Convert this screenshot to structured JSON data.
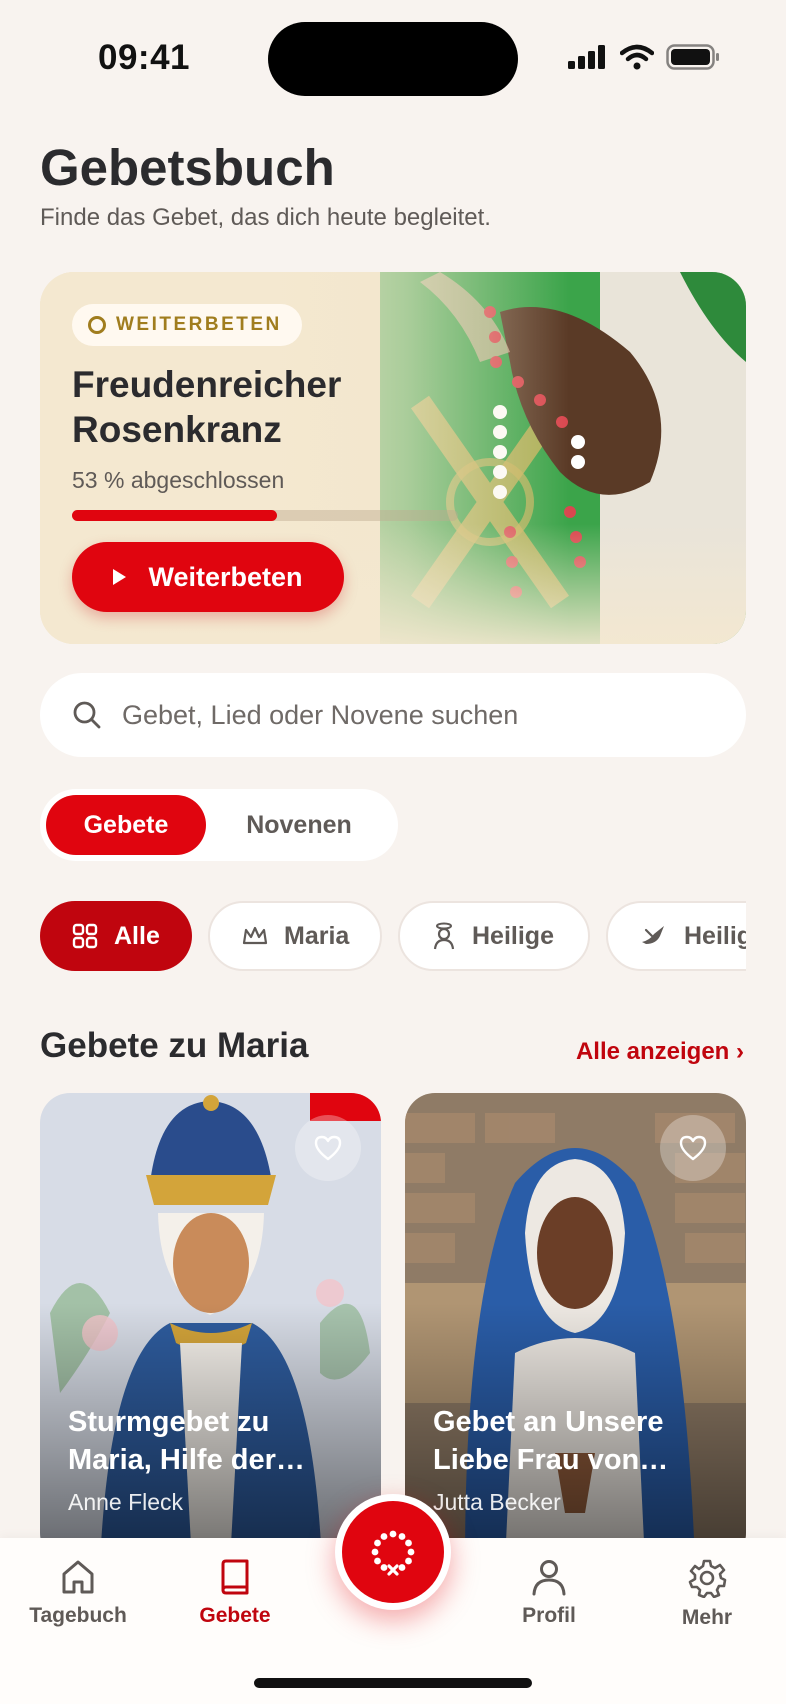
{
  "status_bar": {
    "time": "09:41",
    "icons": [
      "cellular-signal-icon",
      "wifi-icon",
      "battery-icon"
    ]
  },
  "header": {
    "title": "Gebetsbuch",
    "subtitle": "Finde das Gebet, das dich heute begleitet."
  },
  "continue_card": {
    "badge": "WEITERBETEN",
    "title": "Freudenreicher Rosenkranz",
    "progress_text": "53 % abgeschlossen",
    "progress_fraction": 0.53,
    "button_label": "Weiterbeten"
  },
  "search": {
    "placeholder": "Gebet, Lied oder Novene suchen"
  },
  "segments": [
    {
      "label": "Gebete",
      "active": true
    },
    {
      "label": "Novenen",
      "active": false
    }
  ],
  "categories": [
    {
      "label": "Alle",
      "icon": "grid-icon",
      "active": true
    },
    {
      "label": "Maria",
      "icon": "crown-icon",
      "active": false
    },
    {
      "label": "Heilige",
      "icon": "saint-icon",
      "active": false
    },
    {
      "label": "Heilig",
      "icon": "dove-icon",
      "active": false
    }
  ],
  "section": {
    "title": "Gebete zu Maria",
    "link": "Alle anzeigen ›"
  },
  "cards": [
    {
      "title": "Sturmgebet zu Maria, Hilfe der…",
      "author": "Anne Fleck"
    },
    {
      "title": "Gebet an Unsere Liebe Frau von…",
      "author": "Jutta Becker"
    }
  ],
  "tabbar": {
    "items": [
      {
        "label": "Tagebuch",
        "icon": "home-icon",
        "active": false
      },
      {
        "label": "Gebete",
        "icon": "book-icon",
        "active": true
      },
      {
        "label": "Profil",
        "icon": "person-icon",
        "active": false
      },
      {
        "label": "Mehr",
        "icon": "gear-icon",
        "active": false
      }
    ],
    "center_icon": "rosary-icon"
  },
  "colors": {
    "accent": "#E0050F",
    "accent_dark": "#C0050E",
    "gold": "#A07D1E",
    "background": "#F8F3EF"
  }
}
